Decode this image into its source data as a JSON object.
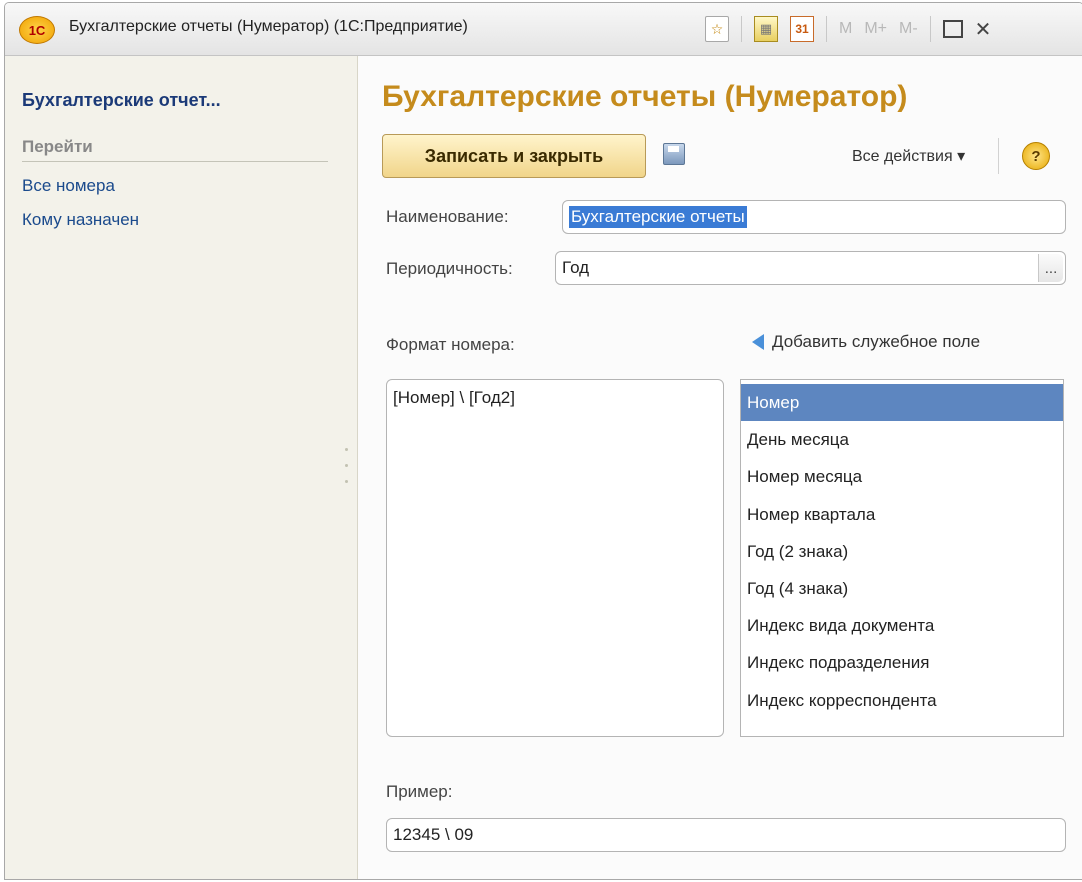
{
  "window": {
    "title": "Бухгалтерские отчеты (Нумератор)  (1С:Предприятие)",
    "logo": "1С",
    "toolbar": {
      "favorites_icon": "☆",
      "calculator_icon": "▦",
      "calendar_icon": "31",
      "m": "M",
      "m_plus": "M+",
      "m_minus": "M-",
      "close": "✕"
    }
  },
  "sidebar": {
    "title": "Бухгалтерские отчет...",
    "section": "Перейти",
    "links": [
      "Все номера",
      "Кому назначен"
    ]
  },
  "form": {
    "title": "Бухгалтерские отчеты (Нумератор)",
    "save_close_label": "Записать и закрыть",
    "all_actions_label": "Все действия ▾",
    "help_label": "?",
    "name_label": "Наименование:",
    "name_value": "Бухгалтерские отчеты",
    "period_label": "Периодичность:",
    "period_value": "Год",
    "period_button": "...",
    "format_label": "Формат номера:",
    "add_field_label": "Добавить служебное поле",
    "format_value": "[Номер] \\ [Год2]",
    "service_fields": [
      "Номер",
      "День месяца",
      "Номер месяца",
      "Номер квартала",
      "Год (2 знака)",
      "Год (4 знака)",
      "Индекс вида документа",
      "Индекс подразделения",
      "Индекс корреспондента"
    ],
    "selected_field": "Номер",
    "example_label": "Пример:",
    "example_value": "12345 \\ 09"
  },
  "colors": {
    "title_accent": "#c58b1c",
    "link": "#1a4a8c",
    "selection": "#5d86c0"
  }
}
